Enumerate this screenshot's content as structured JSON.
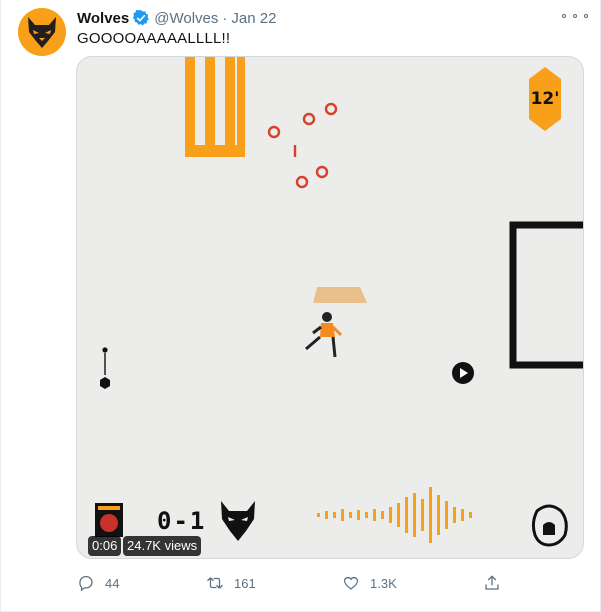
{
  "author": {
    "display_name": "Wolves",
    "handle": "@Wolves",
    "separator": "·",
    "date": "Jan 22"
  },
  "tweet": {
    "text": "GOOOOAAAAALLLL!!"
  },
  "video": {
    "duration": "0:06",
    "views": "24.7K views",
    "minute": "12'",
    "score": "0-1"
  },
  "actions": {
    "replies": "44",
    "retweets": "161",
    "likes": "1.3K"
  },
  "colors": {
    "brand_gold": "#f9a01b",
    "muted_text": "#5b7083",
    "verified_blue": "#1d9bf0",
    "accent_red": "#d9402b"
  },
  "icons": [
    "wolf-logo-icon",
    "verified-badge-icon",
    "more-icon",
    "play-icon",
    "reply-icon",
    "retweet-icon",
    "like-icon",
    "share-icon",
    "premier-league-lion-icon"
  ]
}
